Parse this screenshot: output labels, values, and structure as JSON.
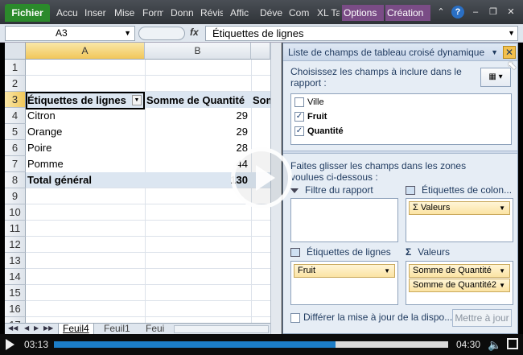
{
  "ribbon": {
    "file_tab": "Fichier",
    "tabs": [
      "Accu",
      "Inser",
      "Mise",
      "Form",
      "Donn",
      "Révis",
      "Affic",
      "Déve",
      "Com",
      "XL Ta"
    ],
    "context_tabs": [
      "Options",
      "Création"
    ]
  },
  "formula_bar": {
    "name_box": "A3",
    "fx": "fx",
    "content": "Étiquettes de lignes"
  },
  "sheet": {
    "col_headers": [
      "A",
      "B"
    ],
    "row_numbers": [
      "1",
      "2",
      "3",
      "4",
      "5",
      "6",
      "7",
      "8",
      "9",
      "10",
      "11",
      "12",
      "13",
      "14",
      "15",
      "16",
      "17"
    ],
    "header_row": {
      "label": "Étiquettes de lignes",
      "value_col": "Somme de Quantité",
      "extra_col": "Som"
    },
    "rows": [
      {
        "label": "Citron",
        "value": "29"
      },
      {
        "label": "Orange",
        "value": "29"
      },
      {
        "label": "Poire",
        "value": "28"
      },
      {
        "label": "Pomme",
        "value": "44"
      }
    ],
    "total": {
      "label": "Total général",
      "value": "130"
    },
    "tabs": [
      "Feuil4",
      "Feuil1",
      "Feui"
    ]
  },
  "pivot_panel": {
    "title": "Liste de champs de tableau croisé dynamique",
    "choose_text": "Choisissez les champs à inclure dans le rapport :",
    "fields": [
      {
        "label": "Ville",
        "checked": false
      },
      {
        "label": "Fruit",
        "checked": true
      },
      {
        "label": "Quantité",
        "checked": true
      }
    ],
    "drag_text": "Faites glisser les champs dans les zones voulues ci-dessous :",
    "zones": {
      "report_filter": "Filtre du rapport",
      "column_labels": "Étiquettes de colon...",
      "row_labels": "Étiquettes de lignes",
      "values": "Valeurs"
    },
    "column_chips": [
      "Valeurs"
    ],
    "row_chips": [
      "Fruit"
    ],
    "value_chips": [
      "Somme de Quantité",
      "Somme de Quantité2"
    ],
    "defer_label": "Différer la mise à jour de la dispo...",
    "update_button": "Mettre à jour"
  },
  "player": {
    "current_time": "03:13",
    "duration": "04:30",
    "progress": 0.715
  },
  "colors": {
    "file_tab": "#2b8a2b",
    "context_tab": "#7a4c86",
    "progress_fill": "#1c7dc7",
    "pivot_band": "#dce6f1"
  }
}
